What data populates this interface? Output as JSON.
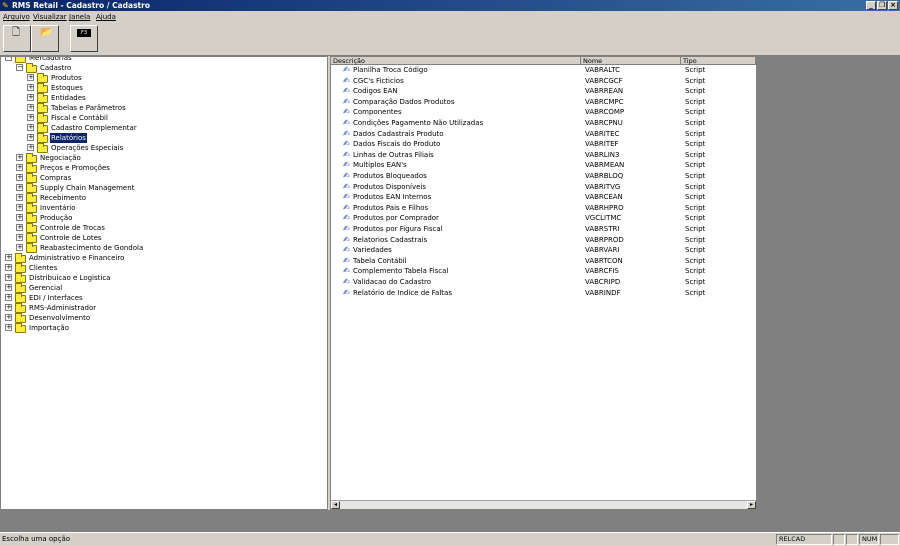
{
  "window": {
    "title": "RMS Retail - Cadastro / Cadastro",
    "minimize_glyph": "_",
    "restore_glyph": "❐",
    "close_glyph": "×"
  },
  "menu": [
    "Arquivo",
    "Visualizar",
    "Janela",
    "Ajuda"
  ],
  "toolbar": {
    "new_icon": "new-document-icon",
    "open_icon": "open-folder-icon",
    "f3_label": "F3"
  },
  "tree": [
    {
      "label": "Mercadorias",
      "level": 0,
      "expanded": true
    },
    {
      "label": "Cadastro",
      "level": 1,
      "expanded": true
    },
    {
      "label": "Produtos",
      "level": 2,
      "expanded": false
    },
    {
      "label": "Estoques",
      "level": 2,
      "expanded": false
    },
    {
      "label": "Entidades",
      "level": 2,
      "expanded": false
    },
    {
      "label": "Tabelas e Parâmetros",
      "level": 2,
      "expanded": false
    },
    {
      "label": "Fiscal e Contábil",
      "level": 2,
      "expanded": false
    },
    {
      "label": "Cadastro Complementar",
      "level": 2,
      "expanded": false
    },
    {
      "label": "Relatórios",
      "level": 2,
      "expanded": false,
      "selected": true,
      "open": true
    },
    {
      "label": "Operações Especiais",
      "level": 2,
      "expanded": false
    },
    {
      "label": "Negociação",
      "level": 1,
      "expanded": false
    },
    {
      "label": "Preços e Promoções",
      "level": 1,
      "expanded": false
    },
    {
      "label": "Compras",
      "level": 1,
      "expanded": false
    },
    {
      "label": "Supply Chain Management",
      "level": 1,
      "expanded": false
    },
    {
      "label": "Recebimento",
      "level": 1,
      "expanded": false
    },
    {
      "label": "Inventário",
      "level": 1,
      "expanded": false
    },
    {
      "label": "Produção",
      "level": 1,
      "expanded": false
    },
    {
      "label": "Controle de Trocas",
      "level": 1,
      "expanded": false
    },
    {
      "label": "Controle de Lotes",
      "level": 1,
      "expanded": false
    },
    {
      "label": "Reabastecimento de Gondola",
      "level": 1,
      "expanded": false
    },
    {
      "label": "Administrativo e Financeiro",
      "level": 0,
      "expanded": false
    },
    {
      "label": "Clientes",
      "level": 0,
      "expanded": false
    },
    {
      "label": "Distribuicao e Logistica",
      "level": 0,
      "expanded": false
    },
    {
      "label": "Gerencial",
      "level": 0,
      "expanded": false
    },
    {
      "label": "EDI / Interfaces",
      "level": 0,
      "expanded": false
    },
    {
      "label": "RMS-Administrador",
      "level": 0,
      "expanded": false
    },
    {
      "label": "Desenvolvimento",
      "level": 0,
      "expanded": false
    },
    {
      "label": "Importação",
      "level": 0,
      "expanded": false
    }
  ],
  "list": {
    "columns": [
      "Descrição",
      "Nome",
      "Tipo"
    ],
    "rows": [
      [
        "Planilha Troca Código",
        "VABRALTC",
        "Script"
      ],
      [
        "CGC's Ficticios",
        "VABRCGCF",
        "Script"
      ],
      [
        "Codigos EAN",
        "VABRREAN",
        "Script"
      ],
      [
        "Comparação Dados Produtos",
        "VABRCMPC",
        "Script"
      ],
      [
        "Componentes",
        "VABRCOMP",
        "Script"
      ],
      [
        "Condições Pagamento Não Utilizadas",
        "VABRCPNU",
        "Script"
      ],
      [
        "Dados Cadastrais Produto",
        "VABRITEC",
        "Script"
      ],
      [
        "Dados Fiscais do Produto",
        "VABRITEF",
        "Script"
      ],
      [
        "Linhas de Outras Filiais",
        "VABRLIN3",
        "Script"
      ],
      [
        "Multiplos EAN's",
        "VABRMEAN",
        "Script"
      ],
      [
        "Produtos Bloqueados",
        "VABRBLOQ",
        "Script"
      ],
      [
        "Produtos Disponíveis",
        "VABRITVG",
        "Script"
      ],
      [
        "Produtos EAN Internos",
        "VABRCEAN",
        "Script"
      ],
      [
        "Produtos Pais e Filhos",
        "VABRHPRO",
        "Script"
      ],
      [
        "Produtos por Comprador",
        "VGCLITMC",
        "Script"
      ],
      [
        "Produtos por Figura Fiscal",
        "VABRSTRI",
        "Script"
      ],
      [
        "Relatorios Cadastrais",
        "VABRPROD",
        "Script"
      ],
      [
        "Variedades",
        "VABRVARI",
        "Script"
      ],
      [
        "Tabela Contábil",
        "VABRTCON",
        "Script"
      ],
      [
        "Complemento Tabela Fiscal",
        "VABRCFIS",
        "Script"
      ],
      [
        "Validacao do Cadastro",
        "VABCRIPD",
        "Script"
      ],
      [
        "Relatório de Indice de Faltas",
        "VABRINDF",
        "Script"
      ]
    ]
  },
  "status": {
    "message": "Escolha uma opção",
    "module": "RELCAD",
    "num": "NUM"
  },
  "scroll": {
    "left_arrow": "◂",
    "right_arrow": "▸"
  }
}
